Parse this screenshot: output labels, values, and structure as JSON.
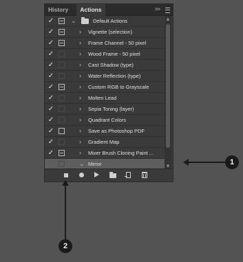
{
  "tabs": {
    "history": "History",
    "actions": "Actions"
  },
  "collapse_label": ">>",
  "action_set": {
    "label": "Default Actions",
    "checked": true,
    "dialog": "on"
  },
  "actions": [
    {
      "label": "Vignette (selection)",
      "checked": true,
      "dialog": "on"
    },
    {
      "label": "Frame Channel - 50 pixel",
      "checked": true,
      "dialog": "on"
    },
    {
      "label": "Wood Frame - 50 pixel",
      "checked": true,
      "dialog": "off"
    },
    {
      "label": "Cast Shadow (type)",
      "checked": true,
      "dialog": "off"
    },
    {
      "label": "Water Reflection (type)",
      "checked": true,
      "dialog": "off"
    },
    {
      "label": "Custom RGB to Grayscale",
      "checked": true,
      "dialog": "on"
    },
    {
      "label": "Molten Lead",
      "checked": true,
      "dialog": "off"
    },
    {
      "label": "Sepia Toning (layer)",
      "checked": true,
      "dialog": "off"
    },
    {
      "label": "Quadrant Colors",
      "checked": true,
      "dialog": "off"
    },
    {
      "label": "Save as Photoshop PDF",
      "checked": true,
      "dialog": "box"
    },
    {
      "label": "Gradient Map",
      "checked": true,
      "dialog": "off"
    },
    {
      "label": "Mixer Brush Cloning Paint ...",
      "checked": true,
      "dialog": "on"
    },
    {
      "label": "Mirror",
      "checked": false,
      "dialog": "off",
      "expanded": true,
      "selected": true
    }
  ],
  "check_glyph": "✓",
  "chevron_collapsed": "›",
  "chevron_expanded": "⌄",
  "callouts": [
    "1",
    "2"
  ]
}
